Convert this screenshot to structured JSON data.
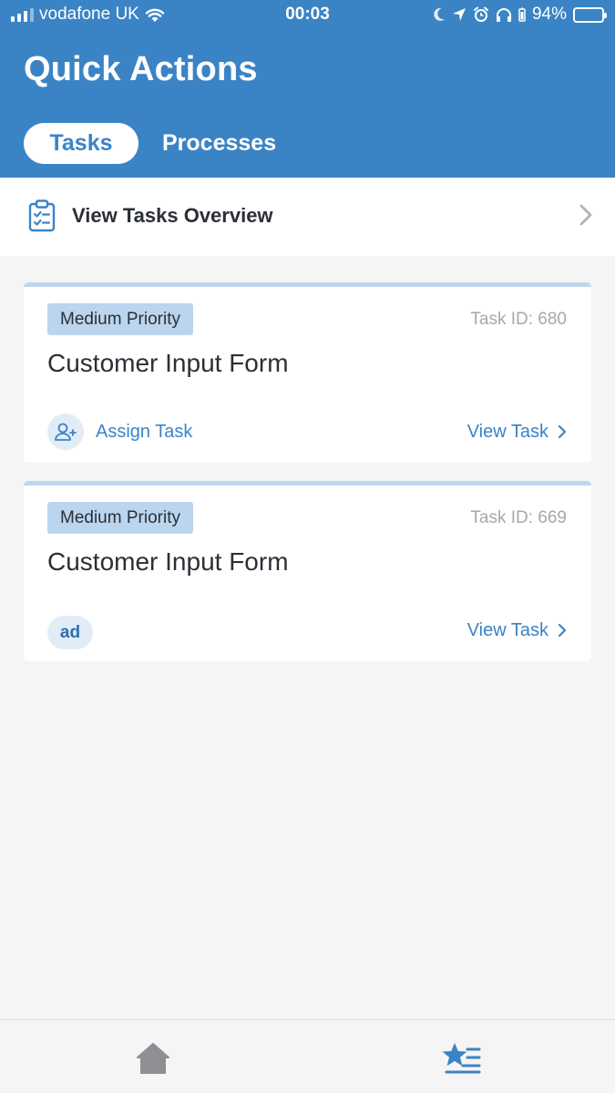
{
  "status_bar": {
    "carrier": "vodafone UK",
    "time": "00:03",
    "battery": "94%"
  },
  "header": {
    "title": "Quick Actions",
    "tabs": [
      {
        "label": "Tasks",
        "active": true
      },
      {
        "label": "Processes",
        "active": false
      }
    ]
  },
  "overview": {
    "label": "View Tasks Overview",
    "icon": "clipboard-check-icon"
  },
  "tasks": [
    {
      "priority": "Medium Priority",
      "task_id": "Task ID: 680",
      "title": "Customer Input Form",
      "assign_label": "Assign Task",
      "view_label": "View Task"
    },
    {
      "priority": "Medium Priority",
      "task_id": "Task ID: 669",
      "title": "Customer Input Form",
      "assignee_initials": "ad",
      "view_label": "View Task"
    }
  ],
  "bottom_nav": [
    {
      "icon": "home-icon",
      "active": false
    },
    {
      "icon": "starred-list-icon",
      "active": true
    }
  ],
  "colors": {
    "brand": "#3a84c5",
    "badge": "#bcd5ee",
    "background": "#f5f5f5",
    "inactive_nav": "#8e8e93"
  }
}
